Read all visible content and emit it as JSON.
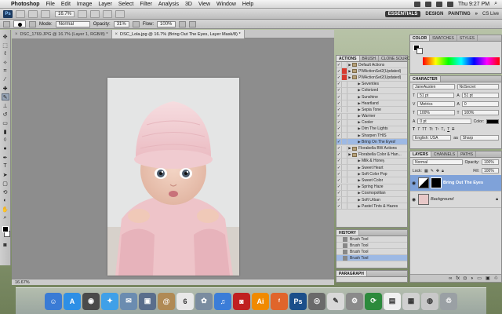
{
  "menubar": {
    "apple": "",
    "app": "Photoshop",
    "items": [
      "File",
      "Edit",
      "Image",
      "Layer",
      "Select",
      "Filter",
      "Analysis",
      "3D",
      "View",
      "Window",
      "Help"
    ],
    "clock": "Thu 9:27 PM"
  },
  "appbar": {
    "ps_badge": "Ps",
    "zoom": "16.7%",
    "workspaces": [
      "ESSENTIALS",
      "DESIGN",
      "PAINTING"
    ],
    "more": "»",
    "cs_live": "CS Live"
  },
  "options": {
    "mode_label": "Mode:",
    "mode_value": "Normal",
    "opacity_label": "Opacity:",
    "opacity_value": "31%",
    "flow_label": "Flow:",
    "flow_value": "100%"
  },
  "document": {
    "tabs": [
      {
        "label": "DSC_1769.JPG @ 16.7% (Layer 1, RGB/8) *",
        "active": false
      },
      {
        "label": "DSC_Lola.jpg @ 16.7% (Bring Out The Eyes, Layer Mask/8) *",
        "active": true
      }
    ],
    "title_line": "DSC_Lola.jpg @ 16.7% (Bring Out The Eyes, Layer Mask/8) *",
    "status": "16.67%"
  },
  "actions_panel": {
    "tabs": [
      "ACTIONS",
      "BRUSH",
      "CLONE SOURCE"
    ],
    "rows": [
      {
        "label": "Default Actions",
        "level": 0,
        "check": "✓",
        "red": false,
        "folder": true,
        "selected": false
      },
      {
        "label": "PWActionSet2(Updated)",
        "level": 0,
        "check": "✓",
        "red": true,
        "folder": true,
        "selected": false
      },
      {
        "label": "PWActionSet2(Updated)",
        "level": 0,
        "check": "✓",
        "red": true,
        "folder": true,
        "selected": false
      },
      {
        "label": "Seventies",
        "level": 1,
        "check": "✓",
        "red": false,
        "folder": false,
        "selected": false
      },
      {
        "label": "Colorized",
        "level": 1,
        "check": "✓",
        "red": false,
        "folder": false,
        "selected": false
      },
      {
        "label": "Sunshine",
        "level": 1,
        "check": "✓",
        "red": false,
        "folder": false,
        "selected": false
      },
      {
        "label": "Heartland",
        "level": 1,
        "check": "✓",
        "red": false,
        "folder": false,
        "selected": false
      },
      {
        "label": "Sepia Tone",
        "level": 1,
        "check": "✓",
        "red": false,
        "folder": false,
        "selected": false
      },
      {
        "label": "Warmer",
        "level": 1,
        "check": "✓",
        "red": false,
        "folder": false,
        "selected": false
      },
      {
        "label": "Cooler",
        "level": 1,
        "check": "✓",
        "red": false,
        "folder": false,
        "selected": false
      },
      {
        "label": "Dim The Lights",
        "level": 1,
        "check": "✓",
        "red": false,
        "folder": false,
        "selected": false
      },
      {
        "label": "Sharpen THIS",
        "level": 1,
        "check": "✓",
        "red": false,
        "folder": false,
        "selected": false
      },
      {
        "label": "Bring On The Eyes!",
        "level": 1,
        "check": "✓",
        "red": false,
        "folder": false,
        "selected": true
      },
      {
        "label": "Florabella BW Actions",
        "level": 0,
        "check": "✓",
        "red": false,
        "folder": true,
        "selected": false
      },
      {
        "label": "Florabella Color & Han...",
        "level": 0,
        "check": "✓",
        "red": false,
        "folder": true,
        "selected": false
      },
      {
        "label": "Milk & Honey",
        "level": 1,
        "check": "✓",
        "red": false,
        "folder": false,
        "selected": false
      },
      {
        "label": "Sweet Heart",
        "level": 1,
        "check": "✓",
        "red": false,
        "folder": false,
        "selected": false
      },
      {
        "label": "Soft Color Pop",
        "level": 1,
        "check": "✓",
        "red": false,
        "folder": false,
        "selected": false
      },
      {
        "label": "Sweet Color",
        "level": 1,
        "check": "✓",
        "red": false,
        "folder": false,
        "selected": false
      },
      {
        "label": "Spring Haze",
        "level": 1,
        "check": "✓",
        "red": false,
        "folder": false,
        "selected": false
      },
      {
        "label": "Cosmopolitan",
        "level": 1,
        "check": "✓",
        "red": false,
        "folder": false,
        "selected": false
      },
      {
        "label": "Soft Urban",
        "level": 1,
        "check": "✓",
        "red": false,
        "folder": false,
        "selected": false
      },
      {
        "label": "Pastel Tints & Hazes",
        "level": 1,
        "check": "✓",
        "red": false,
        "folder": false,
        "selected": false
      }
    ]
  },
  "history_panel": {
    "tabs": [
      "HISTORY"
    ],
    "rows": [
      {
        "label": "Brush Tool",
        "selected": false
      },
      {
        "label": "Brush Tool",
        "selected": false
      },
      {
        "label": "Brush Tool",
        "selected": false
      },
      {
        "label": "Brush Tool",
        "selected": true
      }
    ]
  },
  "paragraph_panel": {
    "tabs": [
      "PARAGRAPH"
    ]
  },
  "color_panel": {
    "tabs": [
      "COLOR",
      "SWATCHES",
      "STYLES"
    ]
  },
  "character_panel": {
    "tabs": [
      "CHARACTER"
    ],
    "font": "JaneAusten",
    "style": "NoSecret",
    "size": "51 pt",
    "leading": "51 pt",
    "kerning": "Metrics",
    "tracking": "0",
    "vscale": "100%",
    "hscale": "100%",
    "baseline": "0 pt",
    "color_label": "Color:",
    "language": "English: USA",
    "aa": "Sharp"
  },
  "layers_panel": {
    "tabs": [
      "LAYERS",
      "CHANNELS",
      "PATHS"
    ],
    "blend": "Normal",
    "opacity_label": "Opacity:",
    "opacity": "100%",
    "lock_label": "Lock:",
    "fill_label": "Fill:",
    "fill": "100%",
    "layers": [
      {
        "name": "Bring Out The Eyes",
        "selected": true,
        "italic": false
      },
      {
        "name": "Background",
        "selected": false,
        "italic": true
      }
    ]
  },
  "dock": {
    "icons": [
      {
        "name": "finder-icon",
        "glyph": "☺",
        "color": "#3a7bd5"
      },
      {
        "name": "app-store-icon",
        "glyph": "A",
        "color": "#2d8fe6"
      },
      {
        "name": "dashboard-icon",
        "glyph": "◉",
        "color": "#4a4a4a"
      },
      {
        "name": "safari-icon",
        "glyph": "✦",
        "color": "#3fa0e8"
      },
      {
        "name": "mail-icon",
        "glyph": "✉",
        "color": "#6b8cb0"
      },
      {
        "name": "iphoto-icon",
        "glyph": "▣",
        "color": "#5a6e8c"
      },
      {
        "name": "addressbook-icon",
        "glyph": "@",
        "color": "#b08a55"
      },
      {
        "name": "ical-icon",
        "glyph": "6",
        "color": "#e8e8e8"
      },
      {
        "name": "iphoto2-icon",
        "glyph": "✿",
        "color": "#7a8ca0"
      },
      {
        "name": "itunes-icon",
        "glyph": "♫",
        "color": "#3b7dd8"
      },
      {
        "name": "photobooth-icon",
        "glyph": "◙",
        "color": "#c02020"
      },
      {
        "name": "illustrator-icon",
        "glyph": "Ai",
        "color": "#f08a00"
      },
      {
        "name": "firefox-icon",
        "glyph": "ᶠ",
        "color": "#e0652b"
      },
      {
        "name": "photoshop-icon",
        "glyph": "Ps",
        "color": "#1b4f8a"
      },
      {
        "name": "preview-icon",
        "glyph": "◎",
        "color": "#6a6a6a"
      },
      {
        "name": "textedit-icon",
        "glyph": "✎",
        "color": "#d8d8d8"
      },
      {
        "name": "system-prefs-icon",
        "glyph": "⚙",
        "color": "#8a8a8a"
      },
      {
        "name": "time-machine-icon",
        "glyph": "⟳",
        "color": "#2c8a3c"
      },
      {
        "name": "doc-stack-icon",
        "glyph": "▤",
        "color": "#f0f0f0"
      },
      {
        "name": "web-stack-icon",
        "glyph": "▦",
        "color": "#d0d0d0"
      },
      {
        "name": "firefox-stack-icon",
        "glyph": "◍",
        "color": "#c8c8c8"
      },
      {
        "name": "trash-icon",
        "glyph": "♲",
        "color": "#9aa0a4"
      }
    ]
  }
}
